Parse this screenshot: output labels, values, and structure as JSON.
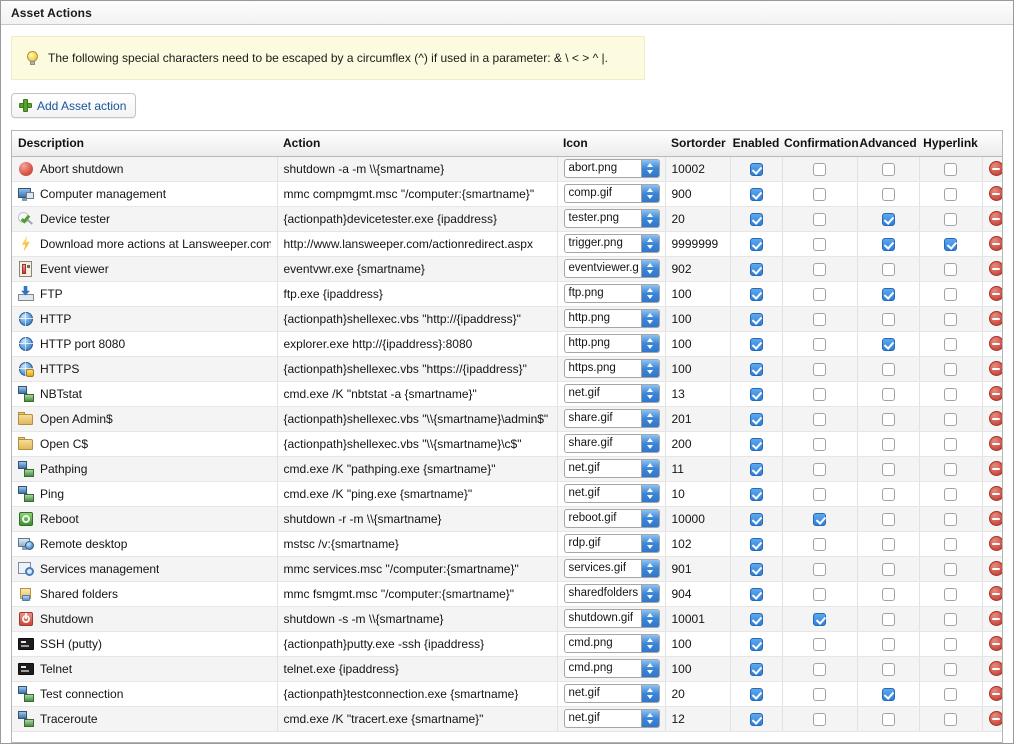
{
  "window": {
    "title": "Asset Actions"
  },
  "tip": {
    "icon": "lightbulb-icon",
    "text": "The following special characters need to be escaped by a circumflex (^) if used in a parameter: & \\ < > ^ |."
  },
  "toolbar": {
    "add_label": "Add Asset action"
  },
  "table": {
    "columns": [
      {
        "key": "description",
        "label": "Description"
      },
      {
        "key": "action",
        "label": "Action"
      },
      {
        "key": "icon",
        "label": "Icon"
      },
      {
        "key": "sortorder",
        "label": "Sortorder"
      },
      {
        "key": "enabled",
        "label": "Enabled"
      },
      {
        "key": "confirmation",
        "label": "Confirmation"
      },
      {
        "key": "advanced",
        "label": "Advanced"
      },
      {
        "key": "hyperlink",
        "label": "Hyperlink"
      },
      {
        "key": "delete",
        "label": ""
      }
    ],
    "rows": [
      {
        "icon": "abort-icon",
        "description": "Abort shutdown",
        "action": "shutdown -a -m \\\\{smartname}",
        "icon_select": "abort.png",
        "sortorder": "10002",
        "enabled": true,
        "confirmation": false,
        "advanced": false,
        "hyperlink": false
      },
      {
        "icon": "monitor-icon",
        "description": "Computer management",
        "action": "mmc compmgmt.msc \"/computer:{smartname}\"",
        "icon_select": "comp.gif",
        "sortorder": "900",
        "enabled": true,
        "confirmation": false,
        "advanced": false,
        "hyperlink": false
      },
      {
        "icon": "tester-icon",
        "description": "Device tester",
        "action": "{actionpath}devicetester.exe {ipaddress}",
        "icon_select": "tester.png",
        "sortorder": "20",
        "enabled": true,
        "confirmation": false,
        "advanced": true,
        "hyperlink": false
      },
      {
        "icon": "bolt-icon",
        "description": "Download more actions at Lansweeper.com",
        "action": "http://www.lansweeper.com/actionredirect.aspx",
        "icon_select": "trigger.png",
        "sortorder": "9999999",
        "enabled": true,
        "confirmation": false,
        "advanced": true,
        "hyperlink": true
      },
      {
        "icon": "event-icon",
        "description": "Event viewer",
        "action": "eventvwr.exe {smartname}",
        "icon_select": "eventviewer.g",
        "sortorder": "902",
        "enabled": true,
        "confirmation": false,
        "advanced": false,
        "hyperlink": false
      },
      {
        "icon": "ftp-icon",
        "description": "FTP",
        "action": "ftp.exe {ipaddress}",
        "icon_select": "ftp.png",
        "sortorder": "100",
        "enabled": true,
        "confirmation": false,
        "advanced": true,
        "hyperlink": false
      },
      {
        "icon": "globe-icon",
        "description": "HTTP",
        "action": "{actionpath}shellexec.vbs \"http://{ipaddress}\"",
        "icon_select": "http.png",
        "sortorder": "100",
        "enabled": true,
        "confirmation": false,
        "advanced": false,
        "hyperlink": false
      },
      {
        "icon": "globe-icon",
        "description": "HTTP port 8080",
        "action": "explorer.exe http://{ipaddress}:8080",
        "icon_select": "http.png",
        "sortorder": "100",
        "enabled": true,
        "confirmation": false,
        "advanced": true,
        "hyperlink": false
      },
      {
        "icon": "globe-lock-icon",
        "description": "HTTPS",
        "action": "{actionpath}shellexec.vbs \"https://{ipaddress}\"",
        "icon_select": "https.png",
        "sortorder": "100",
        "enabled": true,
        "confirmation": false,
        "advanced": false,
        "hyperlink": false
      },
      {
        "icon": "network-icon",
        "description": "NBTstat",
        "action": "cmd.exe /K \"nbtstat -a {smartname}\"",
        "icon_select": "net.gif",
        "sortorder": "13",
        "enabled": true,
        "confirmation": false,
        "advanced": false,
        "hyperlink": false
      },
      {
        "icon": "folder-icon",
        "description": "Open Admin$",
        "action": "{actionpath}shellexec.vbs \"\\\\{smartname}\\admin$\"",
        "icon_select": "share.gif",
        "sortorder": "201",
        "enabled": true,
        "confirmation": false,
        "advanced": false,
        "hyperlink": false
      },
      {
        "icon": "folder-icon",
        "description": "Open C$",
        "action": "{actionpath}shellexec.vbs \"\\\\{smartname}\\c$\"",
        "icon_select": "share.gif",
        "sortorder": "200",
        "enabled": true,
        "confirmation": false,
        "advanced": false,
        "hyperlink": false
      },
      {
        "icon": "network-icon",
        "description": "Pathping",
        "action": "cmd.exe /K \"pathping.exe {smartname}\"",
        "icon_select": "net.gif",
        "sortorder": "11",
        "enabled": true,
        "confirmation": false,
        "advanced": false,
        "hyperlink": false
      },
      {
        "icon": "network-icon",
        "description": "Ping",
        "action": "cmd.exe /K \"ping.exe {smartname}\"",
        "icon_select": "net.gif",
        "sortorder": "10",
        "enabled": true,
        "confirmation": false,
        "advanced": false,
        "hyperlink": false
      },
      {
        "icon": "reboot-icon",
        "description": "Reboot",
        "action": "shutdown -r -m \\\\{smartname}",
        "icon_select": "reboot.gif",
        "sortorder": "10000",
        "enabled": true,
        "confirmation": true,
        "advanced": false,
        "hyperlink": false
      },
      {
        "icon": "rdp-icon",
        "description": "Remote desktop",
        "action": "mstsc /v:{smartname}",
        "icon_select": "rdp.gif",
        "sortorder": "102",
        "enabled": true,
        "confirmation": false,
        "advanced": false,
        "hyperlink": false
      },
      {
        "icon": "services-icon",
        "description": "Services management",
        "action": "mmc services.msc \"/computer:{smartname}\"",
        "icon_select": "services.gif",
        "sortorder": "901",
        "enabled": true,
        "confirmation": false,
        "advanced": false,
        "hyperlink": false
      },
      {
        "icon": "shared-icon",
        "description": "Shared folders",
        "action": "mmc fsmgmt.msc \"/computer:{smartname}\"",
        "icon_select": "sharedfolders",
        "sortorder": "904",
        "enabled": true,
        "confirmation": false,
        "advanced": false,
        "hyperlink": false
      },
      {
        "icon": "shutdown-icon",
        "description": "Shutdown",
        "action": "shutdown -s -m \\\\{smartname}",
        "icon_select": "shutdown.gif",
        "sortorder": "10001",
        "enabled": true,
        "confirmation": true,
        "advanced": false,
        "hyperlink": false
      },
      {
        "icon": "console-icon",
        "description": "SSH (putty)",
        "action": "{actionpath}putty.exe -ssh {ipaddress}",
        "icon_select": "cmd.png",
        "sortorder": "100",
        "enabled": true,
        "confirmation": false,
        "advanced": false,
        "hyperlink": false
      },
      {
        "icon": "console-icon",
        "description": "Telnet",
        "action": "telnet.exe {ipaddress}",
        "icon_select": "cmd.png",
        "sortorder": "100",
        "enabled": true,
        "confirmation": false,
        "advanced": false,
        "hyperlink": false
      },
      {
        "icon": "network-icon",
        "description": "Test connection",
        "action": "{actionpath}testconnection.exe {smartname}",
        "icon_select": "net.gif",
        "sortorder": "20",
        "enabled": true,
        "confirmation": false,
        "advanced": true,
        "hyperlink": false
      },
      {
        "icon": "network-icon",
        "description": "Traceroute",
        "action": "cmd.exe /K \"tracert.exe {smartname}\"",
        "icon_select": "net.gif",
        "sortorder": "12",
        "enabled": true,
        "confirmation": false,
        "advanced": false,
        "hyperlink": false
      }
    ]
  },
  "colors": {
    "tip_background": "#fcfbdf",
    "link": "#15569c",
    "checkbox_on": "#2d7fdc",
    "delete": "#c6493a",
    "row_alt": "#f4f4f4"
  }
}
